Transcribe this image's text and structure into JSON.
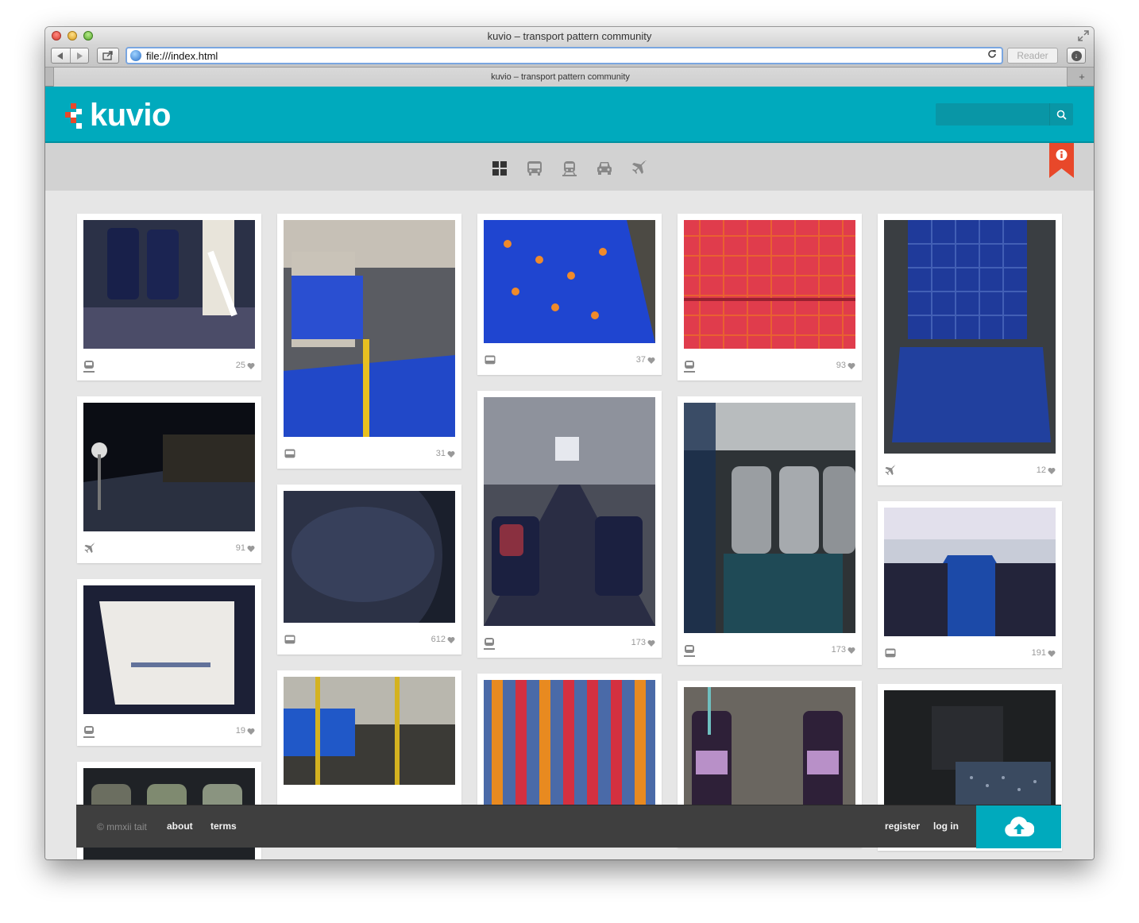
{
  "browser": {
    "window_title": "kuvio – transport pattern community",
    "url": "file:///index.html",
    "reader_label": "Reader",
    "tab_title": "kuvio – transport pattern community"
  },
  "site": {
    "logo_text": "kuvio",
    "brand_color": "#00aabd",
    "accent_color": "#e8482a",
    "search": {
      "placeholder": "",
      "value": ""
    }
  },
  "filters": [
    {
      "icon": "grid-icon",
      "active": true
    },
    {
      "icon": "bus-icon",
      "active": false
    },
    {
      "icon": "train-icon",
      "active": false
    },
    {
      "icon": "car-icon",
      "active": false
    },
    {
      "icon": "plane-icon",
      "active": false
    }
  ],
  "info_icon": "info-icon",
  "photos": [
    {
      "type": "train-icon",
      "likes": "25"
    },
    {
      "type": "plane-icon",
      "likes": "91"
    },
    {
      "type": "train-icon",
      "likes": "19"
    },
    {
      "type": "train-icon",
      "likes": ""
    },
    {
      "type": "bus-icon",
      "likes": "31"
    },
    {
      "type": "bus-icon",
      "likes": "612"
    },
    {
      "type": "train-icon",
      "likes": "173"
    },
    {
      "type": "bus-icon",
      "likes": "37"
    },
    {
      "type": "train-icon",
      "likes": "173"
    },
    {
      "type": "train-icon",
      "likes": ""
    },
    {
      "type": "train-icon",
      "likes": "93"
    },
    {
      "type": "train-icon",
      "likes": "173"
    },
    {
      "type": "train-icon",
      "likes": ""
    },
    {
      "type": "plane-icon",
      "likes": "12"
    },
    {
      "type": "bus-icon",
      "likes": "191"
    },
    {
      "type": "car-icon",
      "likes": ""
    }
  ],
  "footer": {
    "copyright": "© mmxii tait",
    "about": "about",
    "terms": "terms",
    "register": "register",
    "login": "log in",
    "upload_icon": "cloud-upload-icon"
  }
}
